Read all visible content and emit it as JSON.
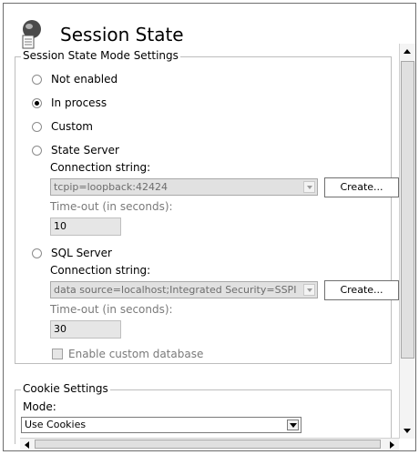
{
  "header": {
    "title": "Session State",
    "icon": "session-state-icon"
  },
  "mode_group": {
    "legend": "Session State Mode Settings",
    "options": [
      {
        "label": "Not enabled",
        "checked": false
      },
      {
        "label": "In process",
        "checked": true
      },
      {
        "label": "Custom",
        "checked": false
      },
      {
        "label": "State Server",
        "checked": false
      },
      {
        "label": "SQL Server",
        "checked": false
      }
    ],
    "state_server": {
      "conn_label": "Connection string:",
      "conn_value": "tcpip=loopback:42424",
      "create_label": "Create...",
      "timeout_label": "Time-out (in seconds):",
      "timeout_value": "10"
    },
    "sql_server": {
      "conn_label": "Connection string:",
      "conn_value": "data source=localhost;Integrated Security=SSPI",
      "create_label": "Create...",
      "timeout_label": "Time-out (in seconds):",
      "timeout_value": "30",
      "custom_db_label": "Enable custom database"
    }
  },
  "cookie_group": {
    "legend": "Cookie Settings",
    "mode_label": "Mode:",
    "mode_value": "Use Cookies"
  }
}
